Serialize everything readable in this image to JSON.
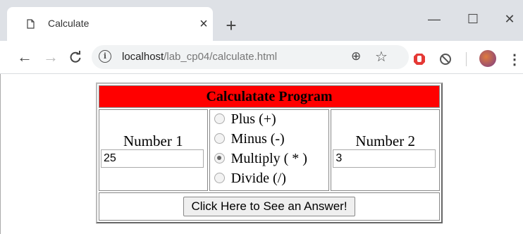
{
  "browser": {
    "tab_title": "Calculate",
    "close_glyph": "×",
    "new_tab_glyph": "+",
    "url_host": "localhost",
    "url_path": "/lab_cp04/calculate.html",
    "window_controls": {
      "minimize": "—",
      "maximize": "☐",
      "close": "✕"
    },
    "nav": {
      "back": "←",
      "forward": "→",
      "reload": "C"
    },
    "info_glyph": "i",
    "zoom_glyph": "⊕",
    "star_glyph": "☆",
    "menu_glyph": "⋮"
  },
  "form": {
    "title": "Calculatate Program",
    "number1_label": "Number 1",
    "number1_value": "25",
    "number2_label": "Number 2",
    "number2_value": "3",
    "operations": [
      {
        "label": "Plus (+)",
        "checked": false
      },
      {
        "label": "Minus (-)",
        "checked": false
      },
      {
        "label": "Multiply ( * )",
        "checked": true
      },
      {
        "label": "Divide (/)",
        "checked": false
      }
    ],
    "submit_label": "Click Here to See an Answer!"
  },
  "colors": {
    "title_bg": "#ff0000",
    "ext_red": "#e53935"
  }
}
